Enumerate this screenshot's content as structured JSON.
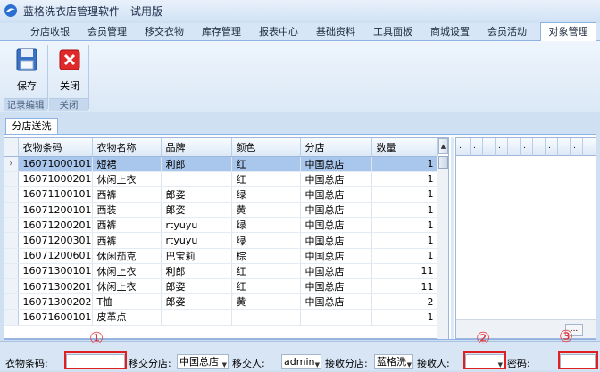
{
  "app": {
    "title": "蓝格洗衣店管理软件—试用版"
  },
  "tabs": [
    {
      "label": "分店收银"
    },
    {
      "label": "会员管理"
    },
    {
      "label": "移交衣物"
    },
    {
      "label": "库存管理"
    },
    {
      "label": "报表中心"
    },
    {
      "label": "基础资料"
    },
    {
      "label": "工具面板"
    },
    {
      "label": "商城设置"
    },
    {
      "label": "会员活动"
    },
    {
      "label": "对象管理"
    }
  ],
  "ribbon": {
    "save_label": "保存",
    "close_label": "关闭",
    "group_record": "记录编辑",
    "group_close": "关闭"
  },
  "doc_tab": "分店送洗",
  "grid": {
    "columns": [
      "衣物条码",
      "衣物名称",
      "品牌",
      "颜色",
      "分店",
      "数量"
    ],
    "rows": [
      {
        "code": "16071000101",
        "name": "短裙",
        "brand": "利郎",
        "color": "红",
        "store": "中国总店",
        "qty": "1"
      },
      {
        "code": "16071000201",
        "name": "休闲上衣",
        "brand": "",
        "color": "红",
        "store": "中国总店",
        "qty": "1"
      },
      {
        "code": "16071100101",
        "name": "西裤",
        "brand": "郎姿",
        "color": "绿",
        "store": "中国总店",
        "qty": "1"
      },
      {
        "code": "16071200101",
        "name": "西装",
        "brand": "郎姿",
        "color": "黄",
        "store": "中国总店",
        "qty": "1"
      },
      {
        "code": "16071200201",
        "name": "西裤",
        "brand": "rtyuyu",
        "color": "绿",
        "store": "中国总店",
        "qty": "1"
      },
      {
        "code": "16071200301",
        "name": "西裤",
        "brand": "rtyuyu",
        "color": "绿",
        "store": "中国总店",
        "qty": "1"
      },
      {
        "code": "16071200601",
        "name": "休闲茄克",
        "brand": "巴宝莉",
        "color": "棕",
        "store": "中国总店",
        "qty": "1"
      },
      {
        "code": "16071300101",
        "name": "休闲上衣",
        "brand": "利郎",
        "color": "红",
        "store": "中国总店",
        "qty": "11"
      },
      {
        "code": "16071300201",
        "name": "休闲上衣",
        "brand": "郎姿",
        "color": "红",
        "store": "中国总店",
        "qty": "11"
      },
      {
        "code": "16071300202",
        "name": "T恤",
        "brand": "郎姿",
        "color": "黄",
        "store": "中国总店",
        "qty": "2"
      },
      {
        "code": "16071600101",
        "name": "皮革点",
        "brand": "",
        "color": "",
        "store": "",
        "qty": "1"
      }
    ]
  },
  "footer": {
    "barcode_label": "衣物条码:",
    "barcode_value": "",
    "transfer_store_label": "移交分店:",
    "transfer_store_value": "中国总店",
    "transferrer_label": "移交人:",
    "transferrer_value": "admin",
    "receive_store_label": "接收分店:",
    "receive_store_value": "蓝格洗",
    "receiver_label": "接收人:",
    "receiver_value": "",
    "password_label": "密码:",
    "password_value": "",
    "markers": [
      "①",
      "②",
      "③"
    ]
  },
  "colors": {
    "selection": "#a9c6ec",
    "annotation": "#e02020",
    "accent": "#8db2e3"
  }
}
